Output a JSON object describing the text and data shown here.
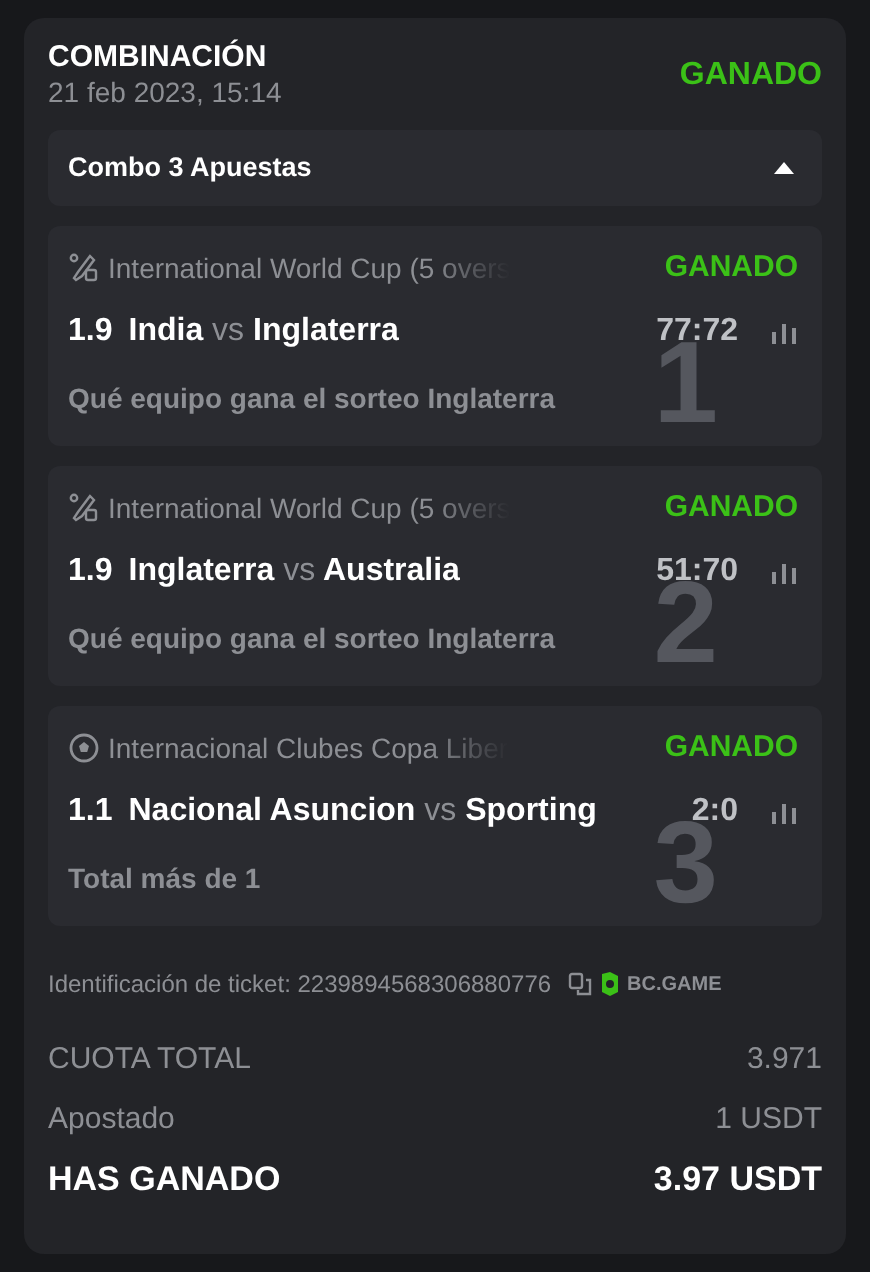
{
  "header": {
    "title": "COMBINACIÓN",
    "date": "21 feb 2023, 15:14",
    "status": "GANADO"
  },
  "combo": {
    "label": "Combo 3 Apuestas",
    "expanded": true
  },
  "bets": [
    {
      "index": "1",
      "kind": "cricket",
      "league": "International World Cup (5 overs",
      "status": "GANADO",
      "odds": "1.9",
      "home": "India",
      "vs": "vs",
      "away": "Inglaterra",
      "score": "77:72",
      "market": "Qué equipo gana el sorteo Inglaterra"
    },
    {
      "index": "2",
      "kind": "cricket",
      "league": "International World Cup (5 overs",
      "status": "GANADO",
      "odds": "1.9",
      "home": "Inglaterra",
      "vs": "vs",
      "away": "Australia",
      "score": "51:70",
      "market": "Qué equipo gana el sorteo Inglaterra"
    },
    {
      "index": "3",
      "kind": "soccer",
      "league": "Internacional Clubes Copa Liber",
      "status": "GANADO",
      "odds": "1.1",
      "home": "Nacional Asuncion",
      "vs": "vs",
      "away": "Sporting",
      "score": "2:0",
      "market": "Total más de 1"
    }
  ],
  "ticket": {
    "label": "Identificación de ticket: 2239894568306880776",
    "brand": "BC.GAME"
  },
  "summary": [
    {
      "kind": "normal",
      "label": "CUOTA TOTAL",
      "value": "3.971"
    },
    {
      "kind": "normal",
      "label": "Apostado",
      "value": "1 USDT"
    },
    {
      "kind": "strong",
      "label": "HAS GANADO",
      "value": "3.97 USDT"
    }
  ]
}
